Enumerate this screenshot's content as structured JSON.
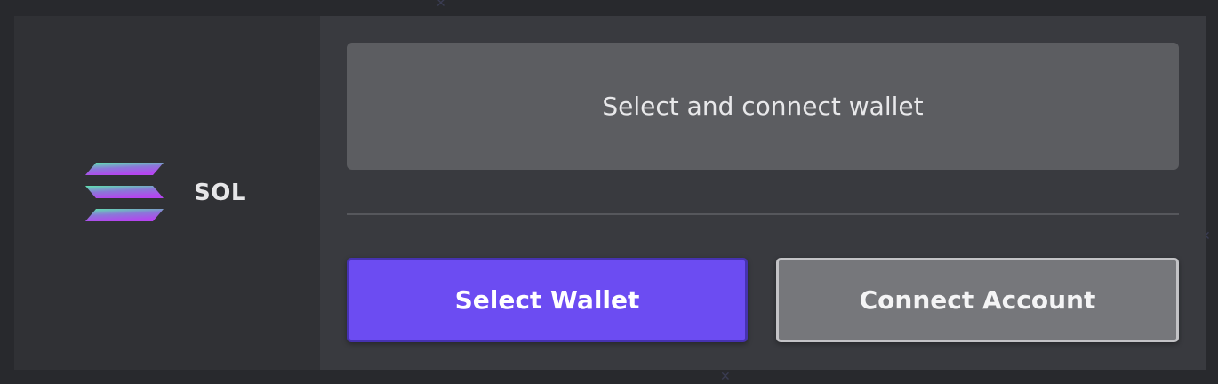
{
  "token": {
    "symbol": "SOL",
    "icon": "solana-logo-icon"
  },
  "wallet": {
    "prompt": "Select and connect wallet"
  },
  "actions": {
    "select_wallet_label": "Select Wallet",
    "connect_account_label": "Connect Account"
  },
  "colors": {
    "primary_button": "#6c4cf2",
    "secondary_button": "#76777b",
    "panel_background": "#393a3f",
    "left_pane_background": "#303135"
  }
}
